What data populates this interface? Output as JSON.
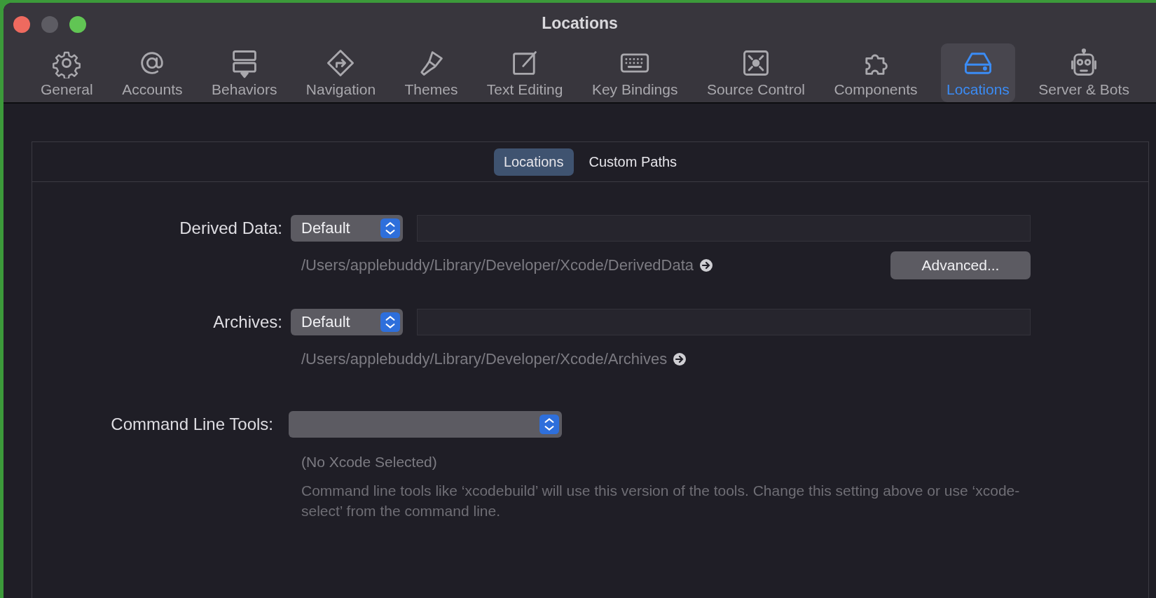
{
  "window": {
    "title": "Locations"
  },
  "toolbar": [
    {
      "label": "General",
      "selected": false
    },
    {
      "label": "Accounts",
      "selected": false
    },
    {
      "label": "Behaviors",
      "selected": false
    },
    {
      "label": "Navigation",
      "selected": false
    },
    {
      "label": "Themes",
      "selected": false
    },
    {
      "label": "Text Editing",
      "selected": false
    },
    {
      "label": "Key Bindings",
      "selected": false
    },
    {
      "label": "Source Control",
      "selected": false
    },
    {
      "label": "Components",
      "selected": false
    },
    {
      "label": "Locations",
      "selected": true
    },
    {
      "label": "Server & Bots",
      "selected": false
    }
  ],
  "tabs": [
    {
      "label": "Locations",
      "selected": true
    },
    {
      "label": "Custom Paths",
      "selected": false
    }
  ],
  "derived_data": {
    "label": "Derived Data:",
    "popup": "Default",
    "path": "/Users/applebuddy/Library/Developer/Xcode/DerivedData",
    "button": "Advanced..."
  },
  "archives": {
    "label": "Archives:",
    "popup": "Default",
    "path": "/Users/applebuddy/Library/Developer/Xcode/Archives"
  },
  "command_line_tools": {
    "label": "Command Line Tools:",
    "note": "(No Xcode Selected)",
    "description": "Command line tools like ‘xcodebuild’ will use this version of the tools. Change this setting above or use ‘xcode-select’ from the command line."
  }
}
